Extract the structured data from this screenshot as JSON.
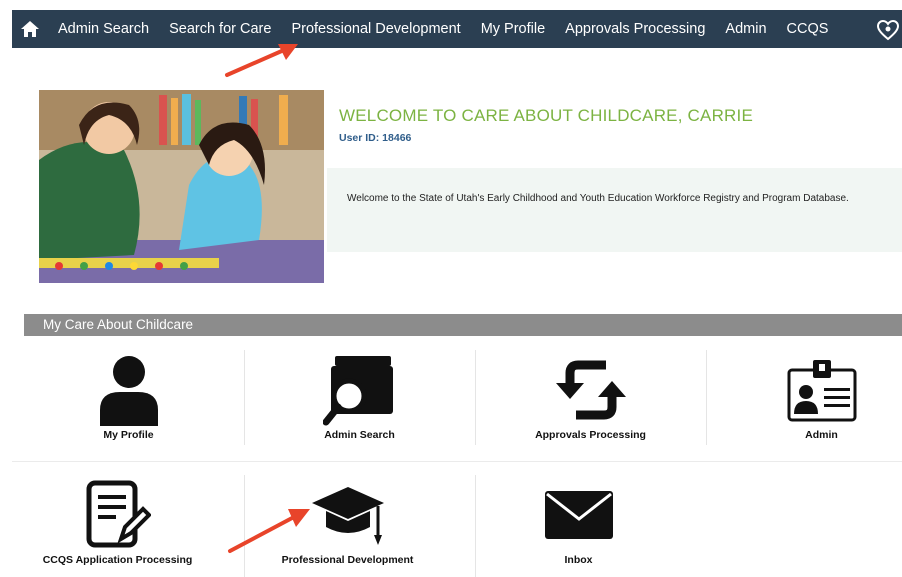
{
  "nav": {
    "items": [
      {
        "label": "Admin Search"
      },
      {
        "label": "Search for Care"
      },
      {
        "label": "Professional Development"
      },
      {
        "label": "My Profile"
      },
      {
        "label": "Approvals Processing"
      },
      {
        "label": "Admin"
      },
      {
        "label": "CCQS"
      }
    ],
    "icons": {
      "home": "home-icon",
      "logo": "care-logo-icon"
    }
  },
  "welcome": {
    "title": "WELCOME TO CARE ABOUT CHILDCARE, CARRIE",
    "user_id": "User ID: 18466",
    "message": "Welcome to the State of Utah's Early Childhood and Youth Education Workforce Registry and Program Database."
  },
  "section": {
    "title": "My Care About Childcare"
  },
  "tiles": [
    {
      "label": "My Profile",
      "icon": "person-icon"
    },
    {
      "label": "Admin Search",
      "icon": "folder-search-icon"
    },
    {
      "label": "Approvals Processing",
      "icon": "refresh-arrows-icon"
    },
    {
      "label": "Admin",
      "icon": "id-badge-icon"
    },
    {
      "label": "CCQS Application Processing",
      "icon": "document-pen-icon"
    },
    {
      "label": "Professional Development",
      "icon": "graduation-cap-icon"
    },
    {
      "label": "Inbox",
      "icon": "envelope-icon"
    }
  ],
  "colors": {
    "navbar": "#2b3f52",
    "accent_green": "#7cb342",
    "section_bar": "#8c8c8c",
    "annotation_arrow": "#e8442a"
  }
}
